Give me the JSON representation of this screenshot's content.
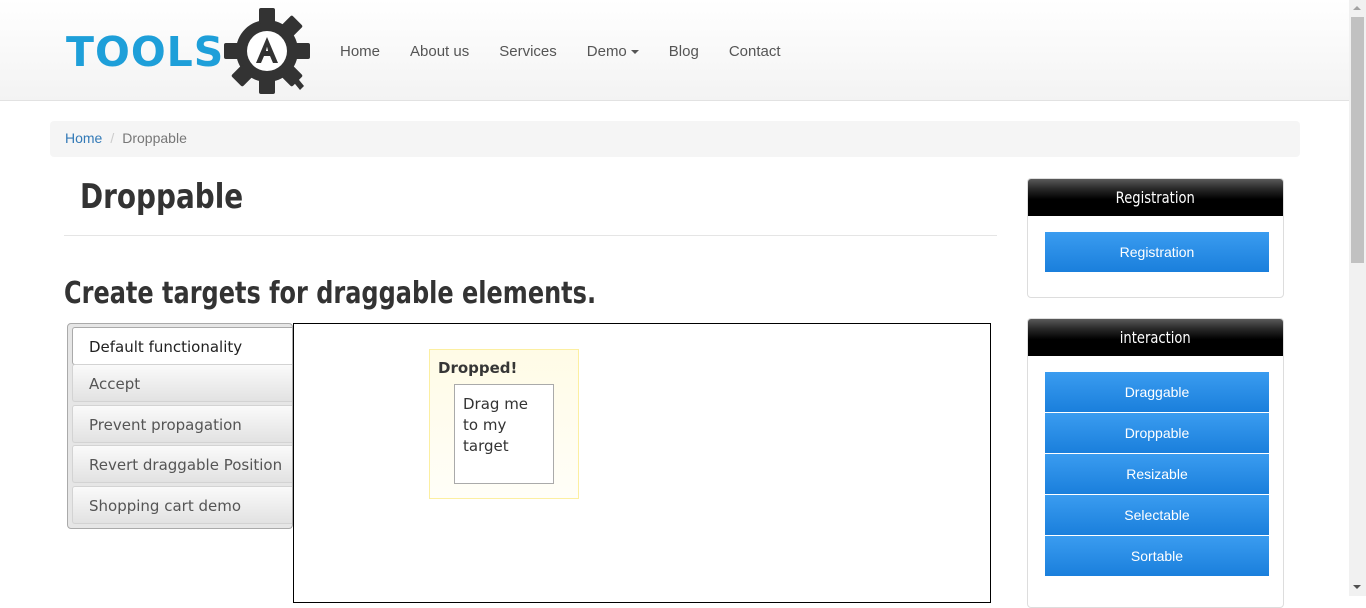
{
  "header": {
    "logo_text": "TOOLS",
    "logo_letter": "A",
    "nav": [
      {
        "label": "Home"
      },
      {
        "label": "About us"
      },
      {
        "label": "Services"
      },
      {
        "label": "Demo"
      },
      {
        "label": "Blog"
      },
      {
        "label": "Contact"
      }
    ]
  },
  "breadcrumb": {
    "home": "Home",
    "separator": "/",
    "current": "Droppable"
  },
  "main": {
    "title": "Droppable",
    "subtitle": "Create targets for draggable elements.",
    "tabs": [
      {
        "label": "Default functionality"
      },
      {
        "label": "Accept"
      },
      {
        "label": "Prevent propagation"
      },
      {
        "label": "Revert draggable Position"
      },
      {
        "label": "Shopping cart demo"
      }
    ],
    "demo": {
      "droppable_label": "Dropped!",
      "draggable_label": "Drag me to my target"
    }
  },
  "sidebar": {
    "registration": {
      "heading": "Registration",
      "buttons": [
        {
          "label": "Registration"
        }
      ]
    },
    "interaction": {
      "heading": "interaction",
      "buttons": [
        {
          "label": "Draggable"
        },
        {
          "label": "Droppable"
        },
        {
          "label": "Resizable"
        },
        {
          "label": "Selectable"
        },
        {
          "label": "Sortable"
        }
      ]
    }
  },
  "colors": {
    "logo_blue": "#1e9fd9",
    "logo_gray": "#333333",
    "button_blue": "#2a8ee8",
    "link_blue": "#337ab7",
    "droppable_highlight": "#fffbe6"
  },
  "icons": [
    "gear-icon",
    "magnifier-icon",
    "caret-down-icon"
  ]
}
